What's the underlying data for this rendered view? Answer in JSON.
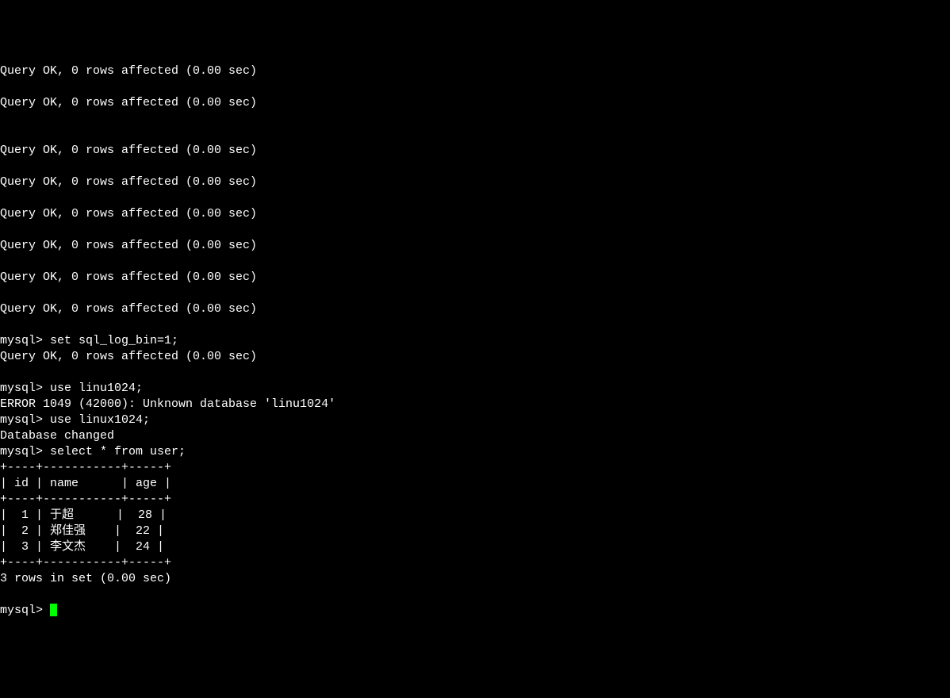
{
  "terminal": {
    "lines": [
      "Query OK, 0 rows affected (0.00 sec)",
      "",
      "Query OK, 0 rows affected (0.00 sec)",
      "",
      "",
      "Query OK, 0 rows affected (0.00 sec)",
      "",
      "Query OK, 0 rows affected (0.00 sec)",
      "",
      "Query OK, 0 rows affected (0.00 sec)",
      "",
      "Query OK, 0 rows affected (0.00 sec)",
      "",
      "Query OK, 0 rows affected (0.00 sec)",
      "",
      "Query OK, 0 rows affected (0.00 sec)",
      "",
      "mysql> set sql_log_bin=1;",
      "Query OK, 0 rows affected (0.00 sec)",
      "",
      "mysql> use linu1024;",
      "ERROR 1049 (42000): Unknown database 'linu1024'",
      "mysql> use linux1024;",
      "Database changed",
      "mysql> select * from user;",
      "+----+-----------+-----+",
      "| id | name      | age |",
      "+----+-----------+-----+",
      "|  1 | 于超      |  28 |",
      "|  2 | 郑佳强    |  22 |",
      "|  3 | 李文杰    |  24 |",
      "+----+-----------+-----+",
      "3 rows in set (0.00 sec)",
      "",
      "mysql> "
    ],
    "prompt": "mysql> ",
    "cursor_color": "#00ff00"
  },
  "table_data": {
    "columns": [
      "id",
      "name",
      "age"
    ],
    "rows": [
      {
        "id": 1,
        "name": "于超",
        "age": 28
      },
      {
        "id": 2,
        "name": "郑佳强",
        "age": 22
      },
      {
        "id": 3,
        "name": "李文杰",
        "age": 24
      }
    ],
    "result_summary": "3 rows in set (0.00 sec)"
  }
}
